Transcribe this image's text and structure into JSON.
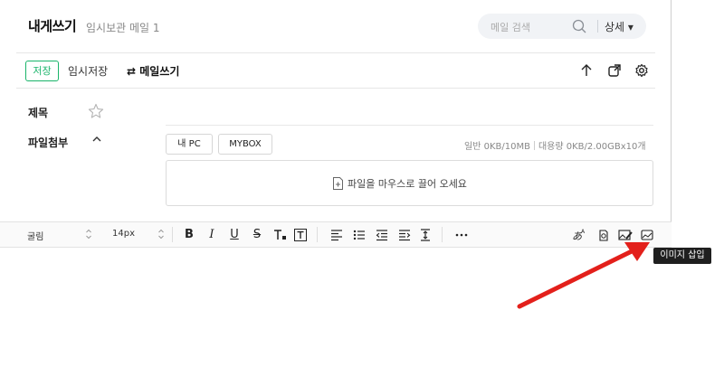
{
  "header": {
    "title": "내게쓰기",
    "subtitle": "임시보관 메일 1",
    "search_placeholder": "메일 검색",
    "detail_label": "상세 ▾"
  },
  "toolbar": {
    "save_label": "저장",
    "draft_label": "임시저장",
    "write_label": "⇄ 메일쓰기",
    "icons": [
      "up-arrow-icon",
      "popout-icon",
      "gear-icon"
    ]
  },
  "fields": {
    "subject_label": "제목",
    "attach_label": "파일첨부",
    "chips": [
      "내 PC",
      "MYBOX"
    ],
    "quota_general": "일반 0KB/10MB",
    "quota_large": "대용량 0KB/2.00GBx10개",
    "drop_text": "파일을 마우스로 끌어 오세요"
  },
  "editor": {
    "font": "굴림",
    "size": "14px",
    "tooltip": "이미지 삽입"
  },
  "colors": {
    "accent": "#19b46a",
    "annotation_arrow": "#e3201b"
  }
}
